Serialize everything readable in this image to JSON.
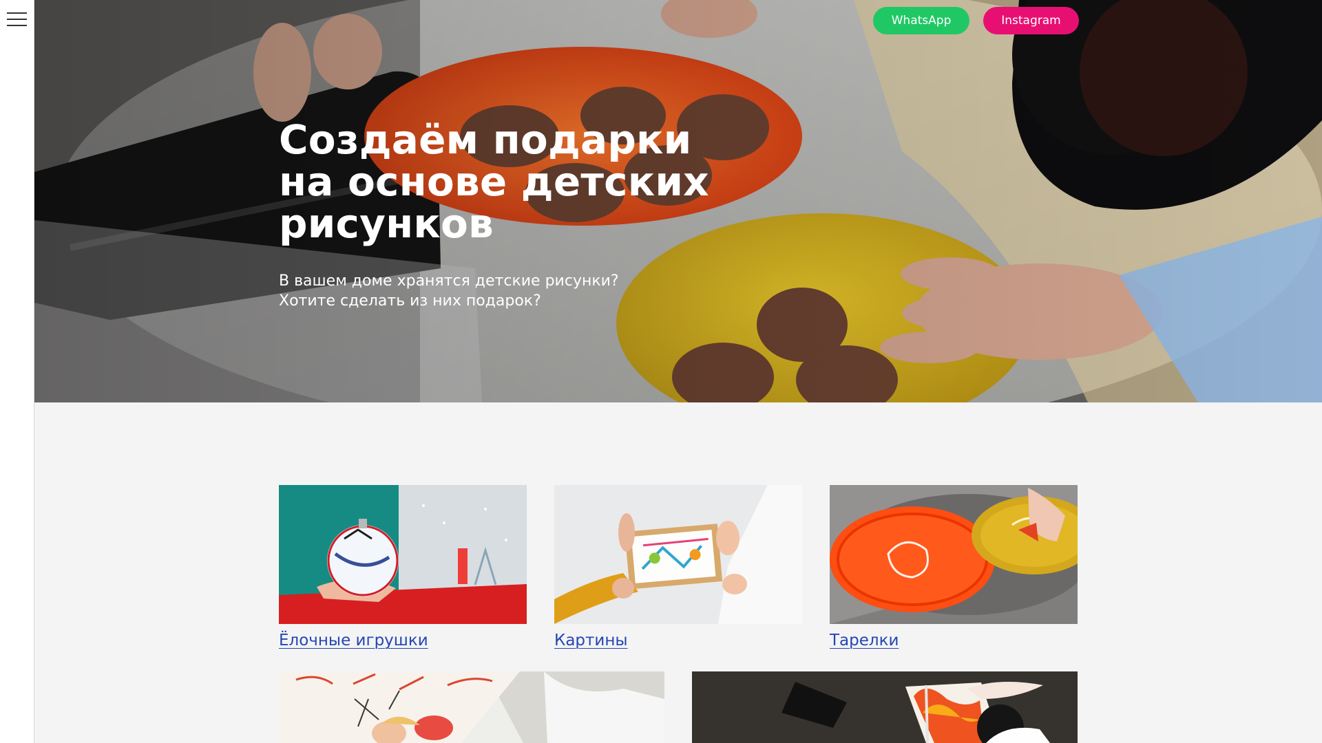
{
  "menu": {
    "icon": "hamburger-menu-icon"
  },
  "hero": {
    "title_lines": [
      "Создаём подарки",
      "на основе детских",
      "рисунков"
    ],
    "subtitle_lines": [
      "В вашем доме хранятся детские рисунки?",
      "Хотите сделать из них подарок?"
    ]
  },
  "social": {
    "whatsapp": {
      "label": "WhatsApp",
      "color": "#20c765"
    },
    "instagram": {
      "label": "Instagram",
      "color": "#e80f73"
    }
  },
  "products": [
    {
      "label": "Ёлочные игрушки"
    },
    {
      "label": "Картины"
    },
    {
      "label": "Тарелки"
    }
  ],
  "colors": {
    "link": "#2346b5",
    "page_background": "#f4f4f4"
  }
}
